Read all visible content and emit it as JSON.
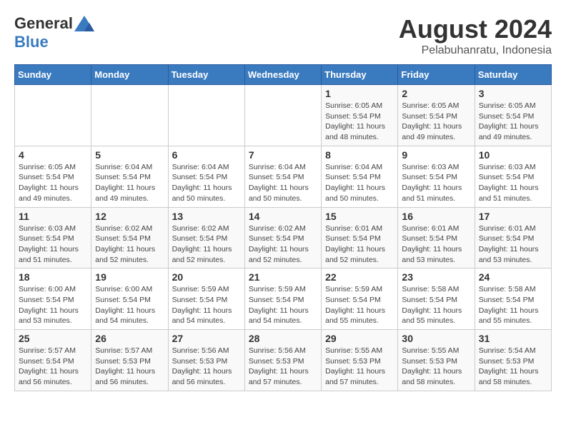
{
  "logo": {
    "general": "General",
    "blue": "Blue"
  },
  "title": "August 2024",
  "subtitle": "Pelabuhanratu, Indonesia",
  "weekdays": [
    "Sunday",
    "Monday",
    "Tuesday",
    "Wednesday",
    "Thursday",
    "Friday",
    "Saturday"
  ],
  "weeks": [
    [
      {
        "day": "",
        "info": ""
      },
      {
        "day": "",
        "info": ""
      },
      {
        "day": "",
        "info": ""
      },
      {
        "day": "",
        "info": ""
      },
      {
        "day": "1",
        "info": "Sunrise: 6:05 AM\nSunset: 5:54 PM\nDaylight: 11 hours\nand 48 minutes."
      },
      {
        "day": "2",
        "info": "Sunrise: 6:05 AM\nSunset: 5:54 PM\nDaylight: 11 hours\nand 49 minutes."
      },
      {
        "day": "3",
        "info": "Sunrise: 6:05 AM\nSunset: 5:54 PM\nDaylight: 11 hours\nand 49 minutes."
      }
    ],
    [
      {
        "day": "4",
        "info": "Sunrise: 6:05 AM\nSunset: 5:54 PM\nDaylight: 11 hours\nand 49 minutes."
      },
      {
        "day": "5",
        "info": "Sunrise: 6:04 AM\nSunset: 5:54 PM\nDaylight: 11 hours\nand 49 minutes."
      },
      {
        "day": "6",
        "info": "Sunrise: 6:04 AM\nSunset: 5:54 PM\nDaylight: 11 hours\nand 50 minutes."
      },
      {
        "day": "7",
        "info": "Sunrise: 6:04 AM\nSunset: 5:54 PM\nDaylight: 11 hours\nand 50 minutes."
      },
      {
        "day": "8",
        "info": "Sunrise: 6:04 AM\nSunset: 5:54 PM\nDaylight: 11 hours\nand 50 minutes."
      },
      {
        "day": "9",
        "info": "Sunrise: 6:03 AM\nSunset: 5:54 PM\nDaylight: 11 hours\nand 51 minutes."
      },
      {
        "day": "10",
        "info": "Sunrise: 6:03 AM\nSunset: 5:54 PM\nDaylight: 11 hours\nand 51 minutes."
      }
    ],
    [
      {
        "day": "11",
        "info": "Sunrise: 6:03 AM\nSunset: 5:54 PM\nDaylight: 11 hours\nand 51 minutes."
      },
      {
        "day": "12",
        "info": "Sunrise: 6:02 AM\nSunset: 5:54 PM\nDaylight: 11 hours\nand 52 minutes."
      },
      {
        "day": "13",
        "info": "Sunrise: 6:02 AM\nSunset: 5:54 PM\nDaylight: 11 hours\nand 52 minutes."
      },
      {
        "day": "14",
        "info": "Sunrise: 6:02 AM\nSunset: 5:54 PM\nDaylight: 11 hours\nand 52 minutes."
      },
      {
        "day": "15",
        "info": "Sunrise: 6:01 AM\nSunset: 5:54 PM\nDaylight: 11 hours\nand 52 minutes."
      },
      {
        "day": "16",
        "info": "Sunrise: 6:01 AM\nSunset: 5:54 PM\nDaylight: 11 hours\nand 53 minutes."
      },
      {
        "day": "17",
        "info": "Sunrise: 6:01 AM\nSunset: 5:54 PM\nDaylight: 11 hours\nand 53 minutes."
      }
    ],
    [
      {
        "day": "18",
        "info": "Sunrise: 6:00 AM\nSunset: 5:54 PM\nDaylight: 11 hours\nand 53 minutes."
      },
      {
        "day": "19",
        "info": "Sunrise: 6:00 AM\nSunset: 5:54 PM\nDaylight: 11 hours\nand 54 minutes."
      },
      {
        "day": "20",
        "info": "Sunrise: 5:59 AM\nSunset: 5:54 PM\nDaylight: 11 hours\nand 54 minutes."
      },
      {
        "day": "21",
        "info": "Sunrise: 5:59 AM\nSunset: 5:54 PM\nDaylight: 11 hours\nand 54 minutes."
      },
      {
        "day": "22",
        "info": "Sunrise: 5:59 AM\nSunset: 5:54 PM\nDaylight: 11 hours\nand 55 minutes."
      },
      {
        "day": "23",
        "info": "Sunrise: 5:58 AM\nSunset: 5:54 PM\nDaylight: 11 hours\nand 55 minutes."
      },
      {
        "day": "24",
        "info": "Sunrise: 5:58 AM\nSunset: 5:54 PM\nDaylight: 11 hours\nand 55 minutes."
      }
    ],
    [
      {
        "day": "25",
        "info": "Sunrise: 5:57 AM\nSunset: 5:54 PM\nDaylight: 11 hours\nand 56 minutes."
      },
      {
        "day": "26",
        "info": "Sunrise: 5:57 AM\nSunset: 5:53 PM\nDaylight: 11 hours\nand 56 minutes."
      },
      {
        "day": "27",
        "info": "Sunrise: 5:56 AM\nSunset: 5:53 PM\nDaylight: 11 hours\nand 56 minutes."
      },
      {
        "day": "28",
        "info": "Sunrise: 5:56 AM\nSunset: 5:53 PM\nDaylight: 11 hours\nand 57 minutes."
      },
      {
        "day": "29",
        "info": "Sunrise: 5:55 AM\nSunset: 5:53 PM\nDaylight: 11 hours\nand 57 minutes."
      },
      {
        "day": "30",
        "info": "Sunrise: 5:55 AM\nSunset: 5:53 PM\nDaylight: 11 hours\nand 58 minutes."
      },
      {
        "day": "31",
        "info": "Sunrise: 5:54 AM\nSunset: 5:53 PM\nDaylight: 11 hours\nand 58 minutes."
      }
    ]
  ]
}
